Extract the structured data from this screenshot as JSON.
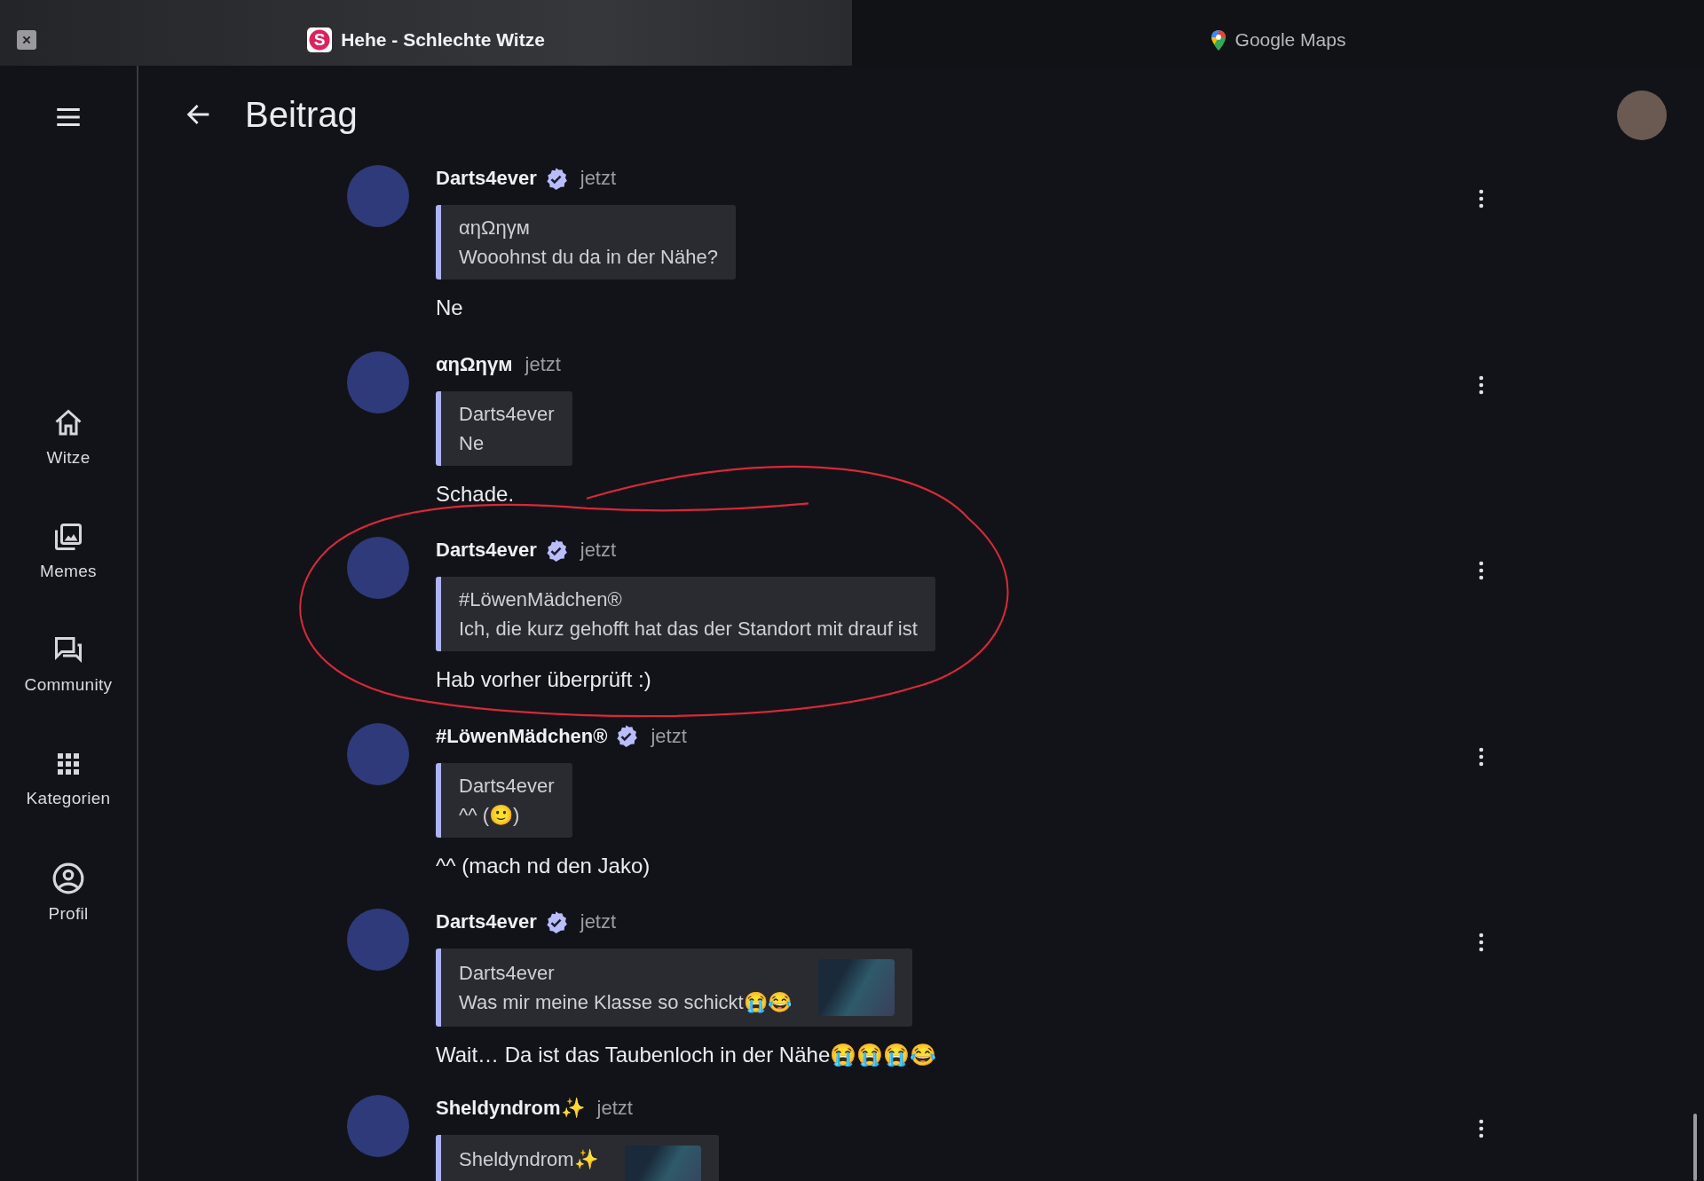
{
  "tabs": [
    {
      "title": "Hehe - Schlechte Witze",
      "kind": "app",
      "icon_letter": "S",
      "selected": true
    },
    {
      "title": "Google Maps",
      "kind": "maps",
      "selected": false
    }
  ],
  "sidebar": {
    "items": [
      {
        "label": "Witze",
        "kind": "home"
      },
      {
        "label": "Memes",
        "kind": "images"
      },
      {
        "label": "Community",
        "kind": "chat"
      },
      {
        "label": "Kategorien",
        "kind": "grid"
      },
      {
        "label": "Profil",
        "kind": "profile"
      }
    ]
  },
  "header": {
    "title": "Beitrag"
  },
  "posts": [
    {
      "author": "Darts4ever",
      "verified": true,
      "time": "jetzt",
      "quote": {
        "author": "αηΩηγм",
        "text": "Wooohnst du da in der Nähe?",
        "thumbnail": false
      },
      "text": "Ne",
      "circled": false
    },
    {
      "author": "αηΩηγм",
      "verified": false,
      "time": "jetzt",
      "quote": {
        "author": "Darts4ever",
        "text": "Ne",
        "thumbnail": false
      },
      "text": "Schade.",
      "circled": false
    },
    {
      "author": "Darts4ever",
      "verified": true,
      "time": "jetzt",
      "quote": {
        "author": "#LöwenMädchen®",
        "text": "Ich, die kurz gehofft hat das der Standort mit drauf ist",
        "thumbnail": false
      },
      "text": "Hab vorher überprüft :)",
      "circled": true
    },
    {
      "author": "#LöwenMädchen®",
      "verified": true,
      "time": "jetzt",
      "quote": {
        "author": "Darts4ever",
        "text": "^^ (🙂)",
        "thumbnail": false
      },
      "text": "^^ (mach nd den Jako)",
      "circled": false
    },
    {
      "author": "Darts4ever",
      "verified": true,
      "time": "jetzt",
      "quote": {
        "author": "Darts4ever",
        "text": "Was mir meine Klasse so schickt😭😂",
        "thumbnail": true
      },
      "text": "Wait… Da ist das Taubenloch in der Nähe😭😭😭😂",
      "circled": false
    },
    {
      "author": "Sheldyndrom✨",
      "verified": false,
      "time": "jetzt",
      "quote": {
        "author": "Sheldyndrom✨",
        "thumbnail": true
      },
      "circled": false
    }
  ]
}
